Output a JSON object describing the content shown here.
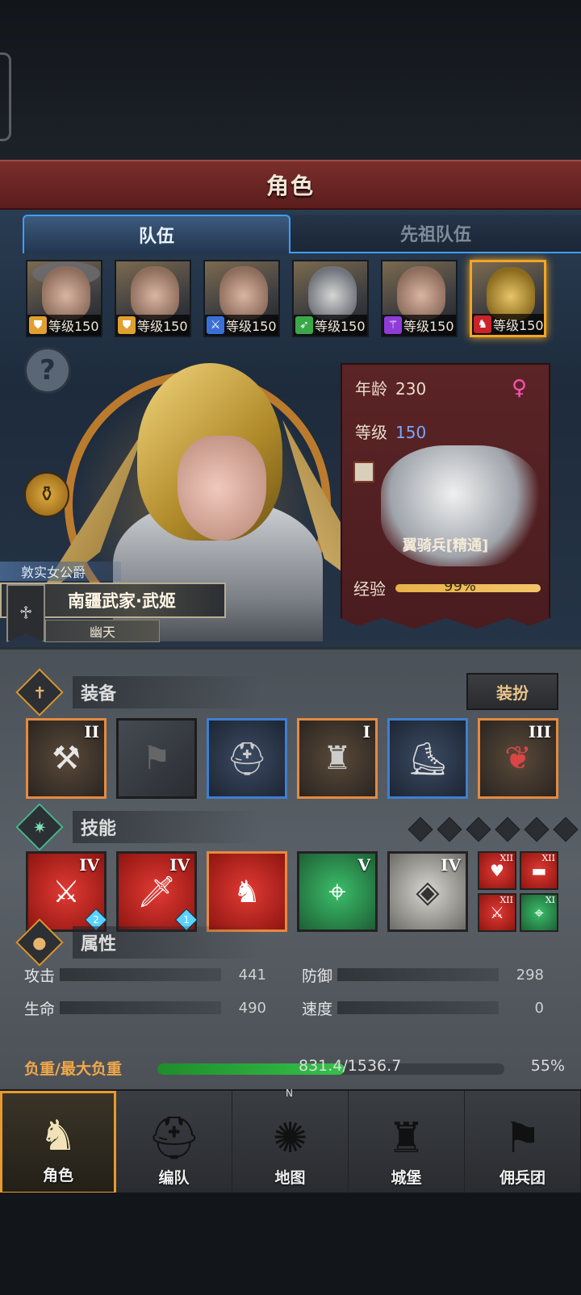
{
  "header": {
    "title": "角色"
  },
  "tabs": [
    {
      "label": "队伍"
    },
    {
      "label": "先祖队伍"
    }
  ],
  "party": [
    {
      "level_text": "等级150",
      "class_color": "#e0a030",
      "class_icon": "shield-icon"
    },
    {
      "level_text": "等级150",
      "class_color": "#e0a030",
      "class_icon": "shield-icon"
    },
    {
      "level_text": "等级150",
      "class_color": "#3b6fd8",
      "class_icon": "sword-icon"
    },
    {
      "level_text": "等级150",
      "class_color": "#3aa84a",
      "class_icon": "bow-icon"
    },
    {
      "level_text": "等级150",
      "class_color": "#8e3bd8",
      "class_icon": "staff-icon"
    },
    {
      "level_text": "等级150",
      "class_color": "#c8242a",
      "class_icon": "horse-icon"
    }
  ],
  "character": {
    "rank_title": "敦实女公爵",
    "name": "南疆武家·武姬",
    "sub_name": "幽天",
    "age_label": "年龄",
    "age": "230",
    "level_label": "等级",
    "level": "150",
    "unit_name": "翼骑兵[精通]",
    "xp_label": "经验",
    "xp_pct": "99%"
  },
  "sections": {
    "equipment": "装备",
    "dress_button": "装扮",
    "skills": "技能",
    "attributes": "属性"
  },
  "equipment": [
    {
      "tier": "II",
      "border": "orange",
      "icon": "mace-icon"
    },
    {
      "tier": "",
      "border": "plain",
      "icon": "flag-icon"
    },
    {
      "tier": "",
      "border": "blue",
      "icon": "helmet-icon"
    },
    {
      "tier": "I",
      "border": "orange",
      "icon": "armor-icon"
    },
    {
      "tier": "",
      "border": "blue",
      "icon": "greaves-icon"
    },
    {
      "tier": "III",
      "border": "orange",
      "icon": "amulet-icon"
    }
  ],
  "skills": [
    {
      "tier": "IV",
      "badge": "2"
    },
    {
      "tier": "IV",
      "badge": "1"
    },
    {
      "tier": ""
    },
    {
      "tier": "V"
    },
    {
      "tier": "IV"
    }
  ],
  "mini_skills": [
    {
      "tier": "XII"
    },
    {
      "tier": "XII"
    },
    {
      "tier": "XII"
    },
    {
      "tier": "XI"
    }
  ],
  "stats": {
    "attack_label": "攻击",
    "attack": "441",
    "defense_label": "防御",
    "defense": "298",
    "hp_label": "生命",
    "hp": "490",
    "speed_label": "速度",
    "speed": "0",
    "load_label": "负重/最大负重",
    "load_value": "831.4/1536.7",
    "load_pct": "55%",
    "load_fraction": 0.54
  },
  "nav": [
    {
      "label": "角色",
      "active": true
    },
    {
      "label": "编队"
    },
    {
      "label": "地图"
    },
    {
      "label": "城堡"
    },
    {
      "label": "佣兵团"
    }
  ],
  "colors": {
    "accent": "#f3a623",
    "tab_active": "#3aa0ff",
    "title_red": "#7a2e2c"
  }
}
